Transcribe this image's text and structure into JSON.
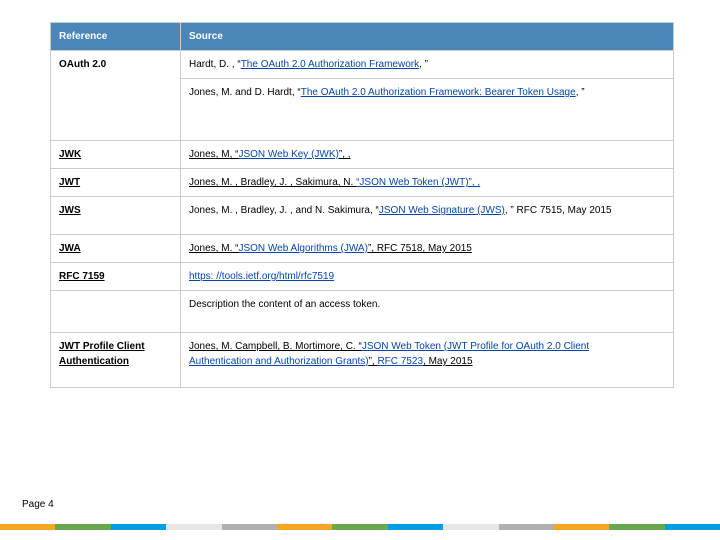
{
  "header": {
    "reference": "Reference",
    "source": "Source"
  },
  "rows": {
    "oauth": {
      "label": "OAuth 2.0",
      "src1a": "Hardt, D. , “",
      "src1link": "The OAuth 2.0 Authorization Framework",
      "src1b": ", ”",
      "src2a": "Jones, M. and D. Hardt, “",
      "src2link": "The OAuth 2.0 Authorization Framework: Bearer Token Usage",
      "src2b": ", ”"
    },
    "jwk": {
      "label": "JWK",
      "pre": "Jones, M, “",
      "link": "JSON Web Key (JWK)",
      "post": "”, ,"
    },
    "jwt": {
      "label": "JWT",
      "pre": "Jones, M. , Bradley, J. , Sakimura, N. ",
      "link": "“JSON Web Token (JWT)”, ,"
    },
    "jws": {
      "label": "JWS",
      "pre": "Jones, M. , Bradley, J. , and N. Sakimura, “",
      "link": "JSON Web Signature (JWS)",
      "post": ", ” RFC 7515, May 2015"
    },
    "jwa": {
      "label": "JWA",
      "pre": "Jones, M. “",
      "link": "JSON Web Algorithms (JWA)",
      "post": "”, RFC 7518, May 2015"
    },
    "rfc7159": {
      "label": "RFC 7159",
      "link": "https: //tools.ietf.org/html/rfc7519"
    },
    "desc": {
      "text": "Description the content of an access token."
    },
    "jwtprofile": {
      "label1": "JWT Profile Client",
      "label2": "Authentication",
      "pre": "Jones, M. Campbell, B. Mortimore, C. “",
      "link1": "JSON Web Token (JWT Profile for OAuth 2.0 Client",
      "link1b": "Authentication and Authorization Grants)",
      "mid": "”, ",
      "link2": "RFC 7523",
      "post": ", May 2015"
    }
  },
  "footer": {
    "page": "Page 4"
  },
  "stripe": [
    "#f5a623",
    "#6aa84f",
    "#009fe3",
    "#e6e6e6",
    "#b0b0b0",
    "#f5a623",
    "#6aa84f",
    "#009fe3",
    "#e6e6e6",
    "#b0b0b0",
    "#f5a623",
    "#6aa84f",
    "#009fe3"
  ]
}
